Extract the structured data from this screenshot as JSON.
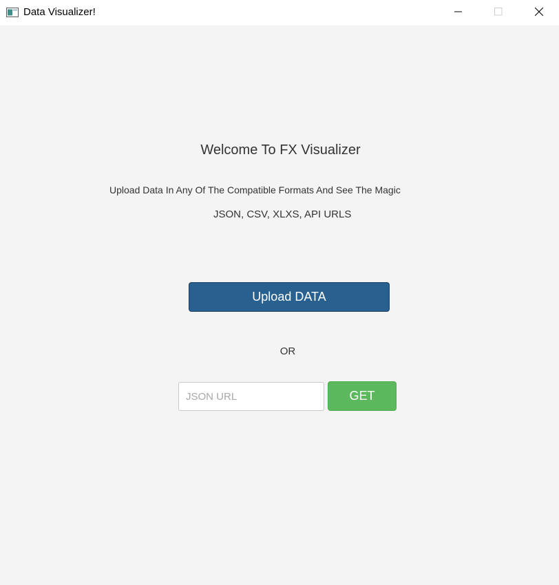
{
  "window": {
    "title": "Data Visualizer!",
    "app_icon": "app-window-icon",
    "controls": {
      "minimize_icon": "minimize-icon",
      "maximize_icon": "maximize-icon",
      "close_icon": "close-icon"
    }
  },
  "main": {
    "heading": "Welcome To FX Visualizer",
    "subtitle": "Upload Data In Any Of The Compatible Formats And See The Magic",
    "formats": "JSON, CSV, XLXS, API URLS",
    "upload_button_label": "Upload DATA",
    "or_label": "OR",
    "url_input": {
      "value": "",
      "placeholder": "JSON URL"
    },
    "get_button_label": "GET"
  },
  "colors": {
    "upload_button": "#28618f",
    "get_button": "#5cb85c",
    "background": "#f4f4f4"
  }
}
